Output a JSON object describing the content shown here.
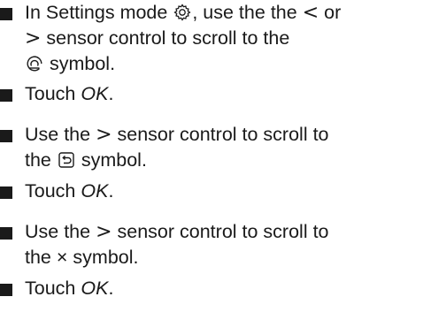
{
  "steps": [
    {
      "pre": "In Settings mode",
      "mid1": ", use the",
      "lt": "<",
      "mid2": "or",
      "gt": ">",
      "mid3": "sensor control to scroll to the",
      "post": "symbol."
    },
    {
      "pre": "Touch",
      "ok": "OK",
      "post": "."
    },
    {
      "pre": "Use the",
      "gt": ">",
      "mid": "sensor control to scroll to",
      "mid2": "the",
      "post": "symbol."
    },
    {
      "pre": "Touch",
      "ok": "OK",
      "post": "."
    },
    {
      "pre": "Use the",
      "gt": ">",
      "mid": "sensor control to scroll to",
      "mid2": "the",
      "x": "×",
      "post": "symbol."
    },
    {
      "pre": "Touch",
      "ok": "OK",
      "post": "."
    }
  ],
  "icons": {
    "settings": "settings-gear-icon",
    "sensor": "sensor-symbol-icon",
    "back": "back-arrow-icon"
  }
}
